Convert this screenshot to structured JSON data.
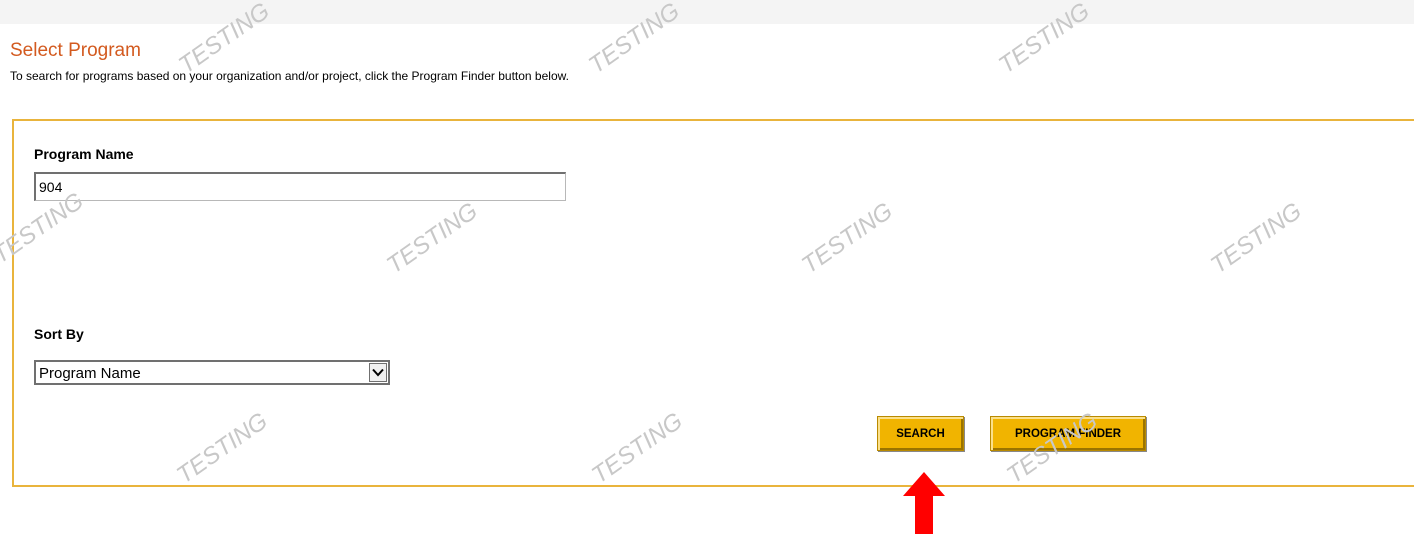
{
  "header": {
    "title": "Select Program",
    "subtitle": "To search for programs based on your organization and/or project, click the Program Finder button below."
  },
  "form": {
    "program_name_label": "Program Name",
    "program_name_value": "904",
    "sort_by_label": "Sort By",
    "sort_by_value": "Program Name",
    "search_button": "SEARCH",
    "program_finder_button": "PROGRAM FINDER"
  },
  "watermark": {
    "text": "TESTING"
  },
  "colors": {
    "title": "#d35a1f",
    "panel_border": "#e9b43c",
    "button": "#f1b400",
    "annotation_arrow": "#ff0000"
  }
}
